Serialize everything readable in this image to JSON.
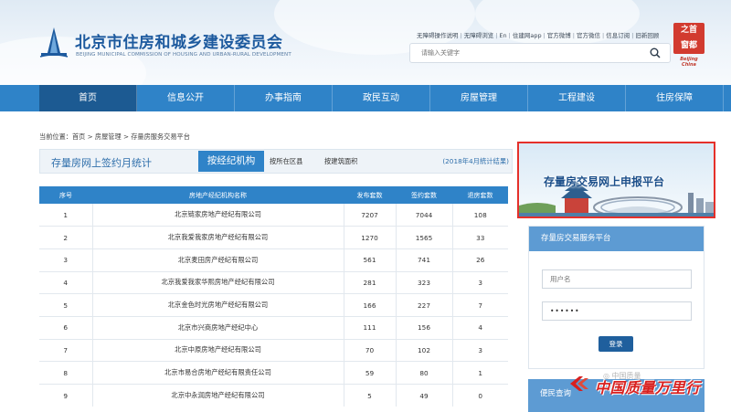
{
  "header": {
    "site_title": "北京市住房和城乡建设委员会",
    "site_subtitle": "BEIJING MUNICIPAL COMMISSION OF HOUSING AND URBAN-RURAL DEVELOPMENT",
    "top_links": [
      "无障碍操作说明",
      "无障碍浏览",
      "En",
      "住建网app",
      "官方微博",
      "官方微信",
      "信息订阅",
      "旧新回顾"
    ],
    "search_placeholder": "请输入关键字",
    "seal_chars": [
      "之",
      "首",
      "窗",
      "都"
    ],
    "seal_caption": "Beijing China"
  },
  "nav": [
    "首页",
    "信息公开",
    "办事指南",
    "政民互动",
    "房屋管理",
    "工程建设",
    "住房保障"
  ],
  "breadcrumb": "当前位置：首页 > 房屋管理 > 存量房服务交易平台",
  "tabs": {
    "stat_title": "存量房网上签约月统计",
    "active_tab": "按经纪机构",
    "tab_district": "按所在区县",
    "tab_area": "按建筑面积",
    "stat_note": "(2018年4月統计结果)"
  },
  "table": {
    "headers": [
      "序号",
      "房地产经纪机构名称",
      "发布套数",
      "签约套数",
      "退房套数"
    ],
    "rows": [
      [
        "1",
        "北京链家房地产经纪有限公司",
        "7207",
        "7044",
        "108"
      ],
      [
        "2",
        "北京我爱我家房地产经纪有限公司",
        "1270",
        "1565",
        "33"
      ],
      [
        "3",
        "北京麦田房产经纪有限公司",
        "561",
        "741",
        "26"
      ],
      [
        "4",
        "北京我爱我家华熙房地产经纪有限公司",
        "281",
        "323",
        "3"
      ],
      [
        "5",
        "北京金色时光房地产经纪有限公司",
        "166",
        "227",
        "7"
      ],
      [
        "6",
        "北京市兴商房地产经纪中心",
        "111",
        "156",
        "4"
      ],
      [
        "7",
        "北京中原房地产经纪有限公司",
        "70",
        "102",
        "3"
      ],
      [
        "8",
        "北京市易合房地产经纪有限责任公司",
        "59",
        "80",
        "1"
      ],
      [
        "9",
        "北京中永润房地产经纪有限公司",
        "5",
        "49",
        "0"
      ]
    ]
  },
  "banner": {
    "title": "存量房交易网上申报平台"
  },
  "login": {
    "title": "存量房交易服务平台",
    "username_placeholder": "用户名",
    "password_value": "••••••",
    "submit_label": "登录"
  },
  "convenience": {
    "title": "便民查询"
  },
  "watermark": {
    "small": "◎ 中国质量",
    "brand": "中国质量万里行"
  },
  "colors": {
    "nav_blue": "#2f83c8",
    "nav_active": "#1c5a92",
    "banner_border": "#e5302a",
    "brand_red": "#d8201f"
  }
}
